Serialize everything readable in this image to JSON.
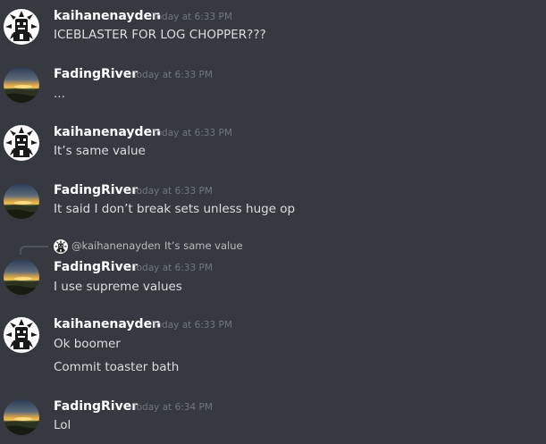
{
  "colors": {
    "background": "#36393f",
    "username": "#ffffff",
    "timestamp": "#72767d",
    "message_text": "#dcddde",
    "reply_text": "#b9bbbe"
  },
  "messages": [
    {
      "author": "kaihanenayden",
      "avatar_icon": "roblox-character-avatar-icon",
      "timestamp": "Today at 6:33 PM",
      "lines": [
        "ICEBLASTER FOR LOG CHOPPER???"
      ]
    },
    {
      "author": "FadingRiver",
      "avatar_icon": "sunset-landscape-avatar-icon",
      "timestamp": "Today at 6:33 PM",
      "lines": [
        "..."
      ]
    },
    {
      "author": "kaihanenayden",
      "avatar_icon": "roblox-character-avatar-icon",
      "timestamp": "Today at 6:33 PM",
      "lines": [
        "It’s same value"
      ]
    },
    {
      "author": "FadingRiver",
      "avatar_icon": "sunset-landscape-avatar-icon",
      "timestamp": "Today at 6:33 PM",
      "lines": [
        "It said I don’t break sets unless huge op"
      ]
    },
    {
      "author": "FadingRiver",
      "avatar_icon": "sunset-landscape-avatar-icon",
      "timestamp": "Today at 6:33 PM",
      "lines": [
        "I use supreme values"
      ],
      "reply": {
        "author": "@kaihanenayden",
        "text": "It’s same value"
      }
    },
    {
      "author": "kaihanenayden",
      "avatar_icon": "roblox-character-avatar-icon",
      "timestamp": "Today at 6:33 PM",
      "lines": [
        "Ok boomer",
        "Commit toaster bath"
      ]
    },
    {
      "author": "FadingRiver",
      "avatar_icon": "sunset-landscape-avatar-icon",
      "timestamp": "Today at 6:34 PM",
      "lines": [
        "Lol"
      ]
    }
  ]
}
